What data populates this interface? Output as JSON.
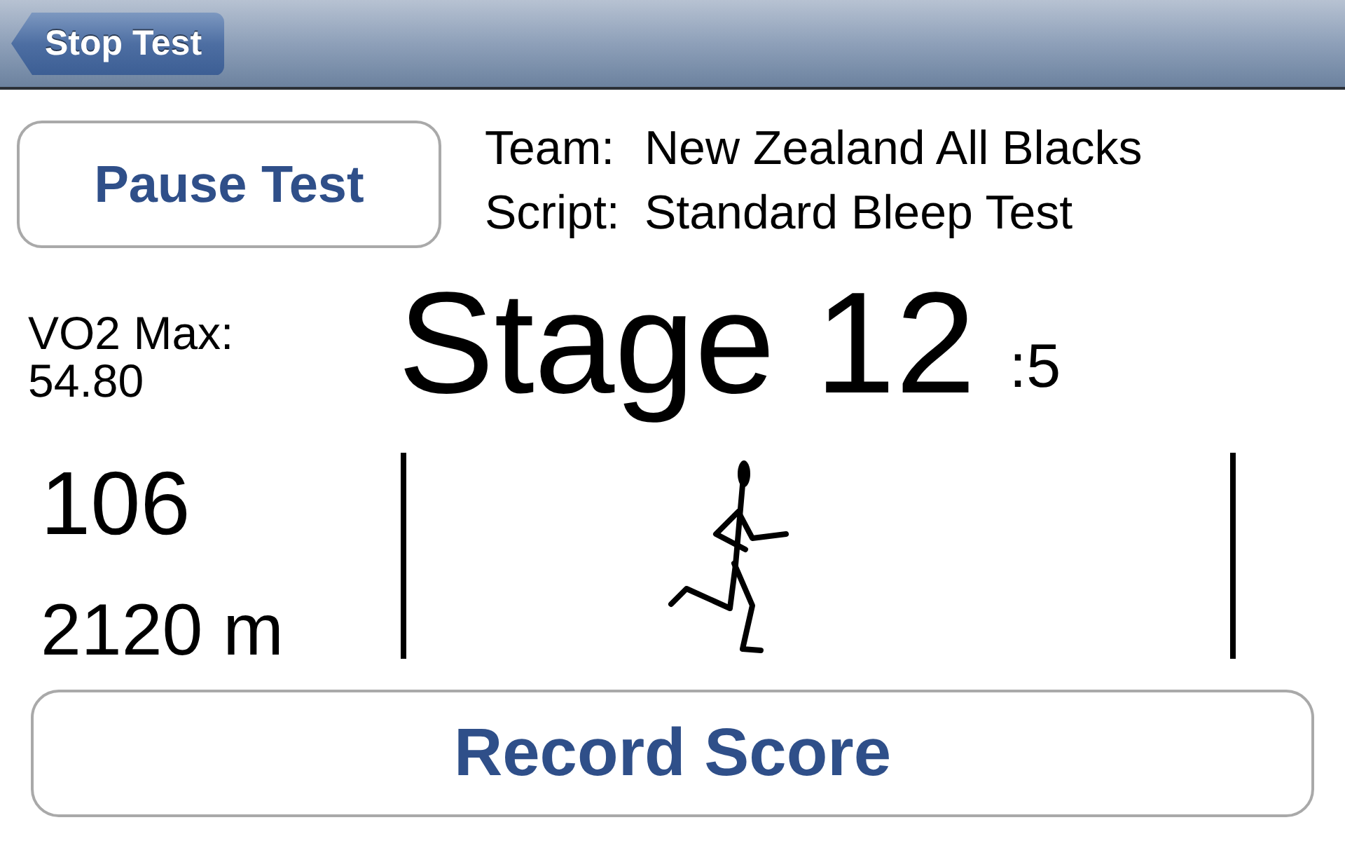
{
  "nav_bar": {
    "back_button": "Stop Test"
  },
  "pause_button": "Pause Test",
  "test_info": [
    {
      "label": "Team:",
      "value": "New Zealand All Blacks"
    },
    {
      "label": "Script:",
      "value": "Standard Bleep Test"
    }
  ],
  "vo2_max": {
    "label": "VO2 Max:",
    "value": "54.80"
  },
  "stage": {
    "title": "Stage 12",
    "shuttle": ":5"
  },
  "readouts": [
    {
      "kind": "count",
      "text": "106"
    },
    {
      "kind": "distance",
      "text": "2120 m"
    }
  ],
  "record_button": "Record Score"
}
